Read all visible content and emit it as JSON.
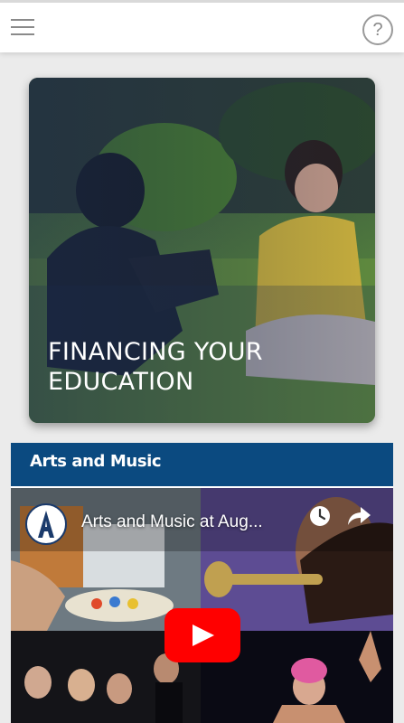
{
  "header": {
    "menu_icon": "hamburger-menu-icon",
    "help_label": "?"
  },
  "hero": {
    "title_line1": "FINANCING YOUR",
    "title_line2": "EDUCATION"
  },
  "section": {
    "title": "Arts and Music",
    "video": {
      "title": "Arts and Music at Aug...",
      "channel_logo_letter": "A"
    }
  },
  "colors": {
    "header_blue": "#0b4a80",
    "youtube_red": "#ff0000"
  }
}
